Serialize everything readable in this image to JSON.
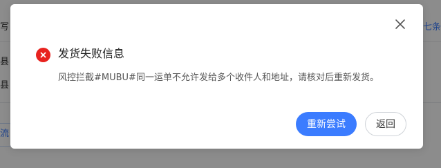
{
  "background": {
    "fragments": {
      "f1": "写",
      "f2": "县",
      "f3": "县",
      "f4": "流",
      "f5": "七条"
    }
  },
  "dialog": {
    "title": "发货失败信息",
    "message": "风控拦截#MUBU#同一运单不允许发给多个收件人和地址，请核对后重新发货。",
    "retry_label": "重新尝试",
    "back_label": "返回",
    "error_icon": "error-circle-icon",
    "close_icon": "close-icon",
    "colors": {
      "primary": "#3b7cff",
      "error": "#e8231f"
    }
  }
}
